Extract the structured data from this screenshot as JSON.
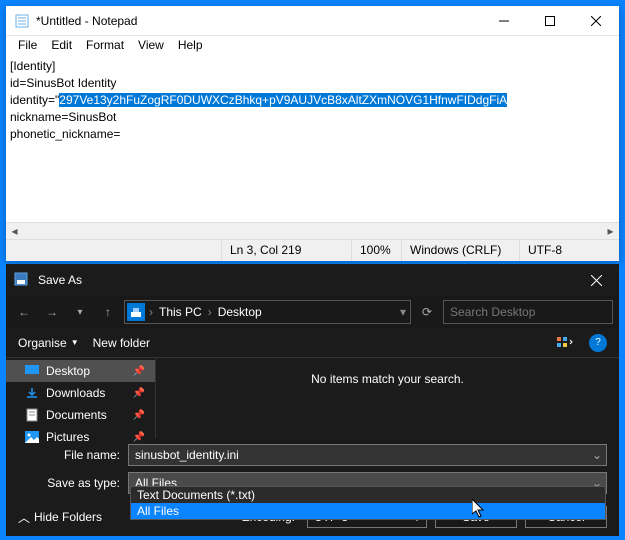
{
  "notepad": {
    "title": "*Untitled - Notepad",
    "menu": [
      "File",
      "Edit",
      "Format",
      "View",
      "Help"
    ],
    "content": {
      "line1": "[Identity]",
      "line2": "id=SinusBot Identity",
      "line3_pre": "identity=\"",
      "line3_sel": "297Ve13y2hFuZogRF0DUWXCzBhkq+pV9AUJVcB8xAltZXmNOVG1HfnwFIDdgFiA",
      "line4": "nickname=SinusBot",
      "line5": "phonetic_nickname="
    },
    "status": {
      "pos": "Ln 3, Col 219",
      "zoom": "100%",
      "eol": "Windows (CRLF)",
      "enc": "UTF-8"
    }
  },
  "saveas": {
    "title": "Save As",
    "breadcrumb": [
      "This PC",
      "Desktop"
    ],
    "search_placeholder": "Search Desktop",
    "toolbar": {
      "organise": "Organise",
      "newfolder": "New folder"
    },
    "tree": [
      {
        "icon": "desktop",
        "label": "Desktop",
        "sel": true
      },
      {
        "icon": "download",
        "label": "Downloads",
        "sel": false
      },
      {
        "icon": "document",
        "label": "Documents",
        "sel": false
      },
      {
        "icon": "picture",
        "label": "Pictures",
        "sel": false
      }
    ],
    "empty_msg": "No items match your search.",
    "filename_label": "File name:",
    "filename": "sinusbot_identity.ini",
    "type_label": "Save as type:",
    "type_value": "All Files",
    "type_options": [
      "Text Documents (*.txt)",
      "All Files"
    ],
    "encoding_label": "Encoding:",
    "encoding": "UTF-8",
    "hide_folders": "Hide Folders",
    "save": "Save",
    "cancel": "Cancel"
  }
}
